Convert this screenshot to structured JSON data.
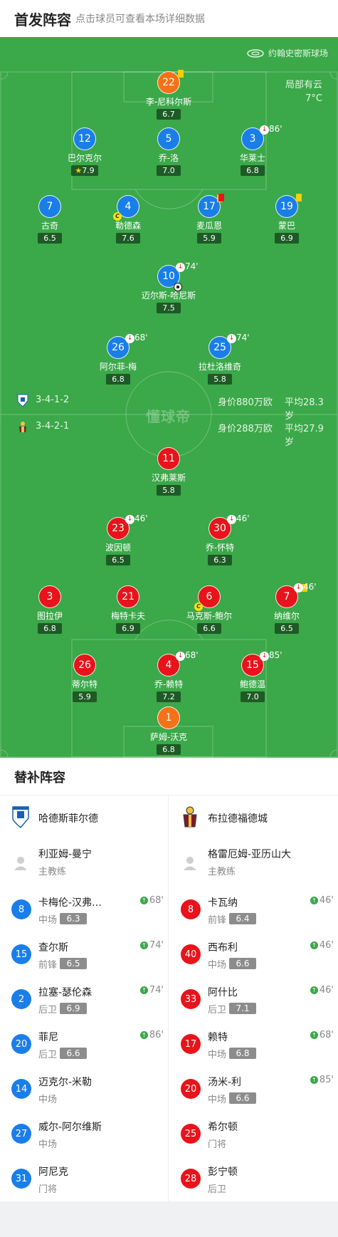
{
  "header": {
    "title": "首发阵容",
    "subtitle": "点击球员可查看本场详细数据"
  },
  "pitch": {
    "stadium": "约翰史密斯球场",
    "weather": "局部有云",
    "temperature": "7°C",
    "watermark": "懂球帝",
    "colors": {
      "grass": "#3ba849",
      "home": "#1a7ee8",
      "away": "#e8131b",
      "goalkeeper": "#f57118"
    }
  },
  "home_team": {
    "formation": "3-4-1-2",
    "value": "身价880万欧",
    "avg_age": "平均28.3岁"
  },
  "away_team": {
    "formation": "3-4-2-1",
    "value": "身价288万欧",
    "avg_age": "平均27.9岁"
  },
  "home_players": [
    {
      "num": "22",
      "name": "李-尼科尔斯",
      "rating": "6.7",
      "gk": true,
      "yellow": true
    },
    {
      "num": "12",
      "name": "巴尔克尔",
      "rating": "7.9",
      "star": true
    },
    {
      "num": "5",
      "name": "乔-洛",
      "rating": "7.0"
    },
    {
      "num": "3",
      "name": "华莱士",
      "rating": "6.8",
      "sub_out": "86'"
    },
    {
      "num": "7",
      "name": "古奇",
      "rating": "6.5"
    },
    {
      "num": "4",
      "name": "勒德森",
      "rating": "7.6",
      "captain": true
    },
    {
      "num": "17",
      "name": "麦瓜恩",
      "rating": "5.9",
      "red": true
    },
    {
      "num": "19",
      "name": "蒙巴",
      "rating": "6.9",
      "yellow": true
    },
    {
      "num": "10",
      "name": "迈尔斯-哈尼斯",
      "rating": "7.5",
      "sub_out": "74'",
      "goal": true
    },
    {
      "num": "26",
      "name": "阿尔菲-梅",
      "rating": "6.8",
      "sub_out": "68'"
    },
    {
      "num": "25",
      "name": "拉杜洛维奇",
      "rating": "5.8",
      "sub_out": "74'"
    }
  ],
  "away_players": [
    {
      "num": "11",
      "name": "汉弗莱斯",
      "rating": "5.8"
    },
    {
      "num": "23",
      "name": "波因顿",
      "rating": "6.5",
      "sub_out": "46'"
    },
    {
      "num": "30",
      "name": "乔-怀特",
      "rating": "6.3",
      "sub_out": "46'"
    },
    {
      "num": "3",
      "name": "图拉伊",
      "rating": "6.8"
    },
    {
      "num": "21",
      "name": "梅特卡夫",
      "rating": "6.9"
    },
    {
      "num": "6",
      "name": "马克斯-鲍尔",
      "rating": "6.6",
      "captain": true
    },
    {
      "num": "7",
      "name": "纳维尔",
      "rating": "6.5",
      "sub_out": "46'",
      "yellow": true
    },
    {
      "num": "26",
      "name": "蒂尔特",
      "rating": "5.9"
    },
    {
      "num": "4",
      "name": "乔-赖特",
      "rating": "7.2",
      "sub_out": "68'"
    },
    {
      "num": "15",
      "name": "鲍德温",
      "rating": "7.0",
      "sub_out": "85'"
    },
    {
      "num": "1",
      "name": "萨姆-沃克",
      "rating": "6.8",
      "gk": true
    }
  ],
  "substitutes": {
    "title": "替补阵容",
    "home": {
      "team_name": "哈德斯菲尔德",
      "coach": {
        "name": "利亚姆-曼宁",
        "role": "主教练"
      },
      "players": [
        {
          "num": "8",
          "name": "卡梅伦-汉弗…",
          "pos": "中场",
          "rating": "6.3",
          "in": "68'"
        },
        {
          "num": "15",
          "name": "查尔斯",
          "pos": "前锋",
          "rating": "6.5",
          "in": "74'"
        },
        {
          "num": "2",
          "name": "拉塞-瑟伦森",
          "pos": "后卫",
          "rating": "6.9",
          "in": "74'"
        },
        {
          "num": "20",
          "name": "菲尼",
          "pos": "后卫",
          "rating": "6.6",
          "in": "86'"
        },
        {
          "num": "14",
          "name": "迈克尔-米勒",
          "pos": "中场"
        },
        {
          "num": "27",
          "name": "威尔-阿尔维斯",
          "pos": "中场"
        },
        {
          "num": "31",
          "name": "阿尼克",
          "pos": "门将"
        }
      ]
    },
    "away": {
      "team_name": "布拉德福德城",
      "coach": {
        "name": "格雷厄姆-亚历山大",
        "role": "主教练"
      },
      "players": [
        {
          "num": "8",
          "name": "卡瓦纳",
          "pos": "前锋",
          "rating": "6.4",
          "in": "46'"
        },
        {
          "num": "40",
          "name": "西布利",
          "pos": "中场",
          "rating": "6.6",
          "in": "46'"
        },
        {
          "num": "33",
          "name": "阿什比",
          "pos": "后卫",
          "rating": "7.1",
          "in": "46'"
        },
        {
          "num": "17",
          "name": "赖特",
          "pos": "中场",
          "rating": "6.8",
          "in": "68'"
        },
        {
          "num": "20",
          "name": "汤米-利",
          "pos": "中场",
          "rating": "6.6",
          "in": "85'"
        },
        {
          "num": "25",
          "name": "希尔顿",
          "pos": "门将"
        },
        {
          "num": "28",
          "name": "彭宁顿",
          "pos": "后卫"
        }
      ]
    }
  }
}
